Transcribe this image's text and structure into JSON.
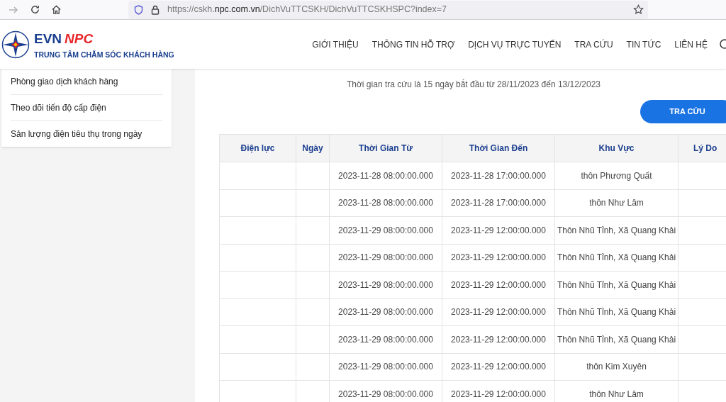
{
  "browser": {
    "url_parts": [
      "https://cskh.",
      "npc.com.vn",
      "/DichVuTTCSKH/DichVuTTCSKHSPC?index=7"
    ]
  },
  "header": {
    "logo_name": [
      "EVN",
      "NPC"
    ],
    "logo_tagline": "TRUNG TÂM CHĂM SÓC KHÁCH HÀNG",
    "nav": [
      "GIỚI THIỆU",
      "THÔNG TIN HỖ TRỢ",
      "DỊCH VỤ TRỰC TUYẾN",
      "TRA CỨU",
      "TIN TỨC",
      "LIÊN HỆ"
    ]
  },
  "sidebar": {
    "items": [
      "Phòng giao dịch khách hàng",
      "Theo dõi tiến độ cấp điện",
      "Sản lượng điện tiêu thụ trong ngày"
    ]
  },
  "notice": "Thời gian tra cứu là 15 ngày bắt đầu từ 28/11/2023 đến 13/12/2023",
  "search_button": "TRA CỨU",
  "table": {
    "columns": [
      "Điện lực",
      "Ngày",
      "Thời Gian Từ",
      "Thời Gian Đến",
      "Khu Vực",
      "Lý Do"
    ],
    "rows": [
      {
        "from": "2023-11-28 08:00:00.000",
        "to": "2023-11-28 17:00:00.000",
        "area": "thôn Phương Quất"
      },
      {
        "from": "2023-11-28 08:00:00.000",
        "to": "2023-11-28 17:00:00.000",
        "area": "thôn Như Lâm"
      },
      {
        "from": "2023-11-29 08:00:00.000",
        "to": "2023-11-29 12:00:00.000",
        "area": "Thôn Nhũ Tỉnh, Xã Quang Khải"
      },
      {
        "from": "2023-11-29 08:00:00.000",
        "to": "2023-11-29 12:00:00.000",
        "area": "Thôn Nhũ Tỉnh, Xã Quang Khải"
      },
      {
        "from": "2023-11-29 08:00:00.000",
        "to": "2023-11-29 12:00:00.000",
        "area": "Thôn Nhũ Tỉnh, Xã Quang Khải"
      },
      {
        "from": "2023-11-29 08:00:00.000",
        "to": "2023-11-29 12:00:00.000",
        "area": "Thôn Nhũ Tỉnh, Xã Quang Khải"
      },
      {
        "from": "2023-11-29 08:00:00.000",
        "to": "2023-11-29 12:00:00.000",
        "area": "Thôn Nhũ Tỉnh, Xã Quang Khải"
      },
      {
        "from": "2023-11-29 08:00:00.000",
        "to": "2023-11-29 12:00:00.000",
        "area": "thôn Kim Xuyên"
      },
      {
        "from": "2023-11-29 08:00:00.000",
        "to": "2023-11-29 12:00:00.000",
        "area": "thôn Như Lâm"
      }
    ]
  }
}
